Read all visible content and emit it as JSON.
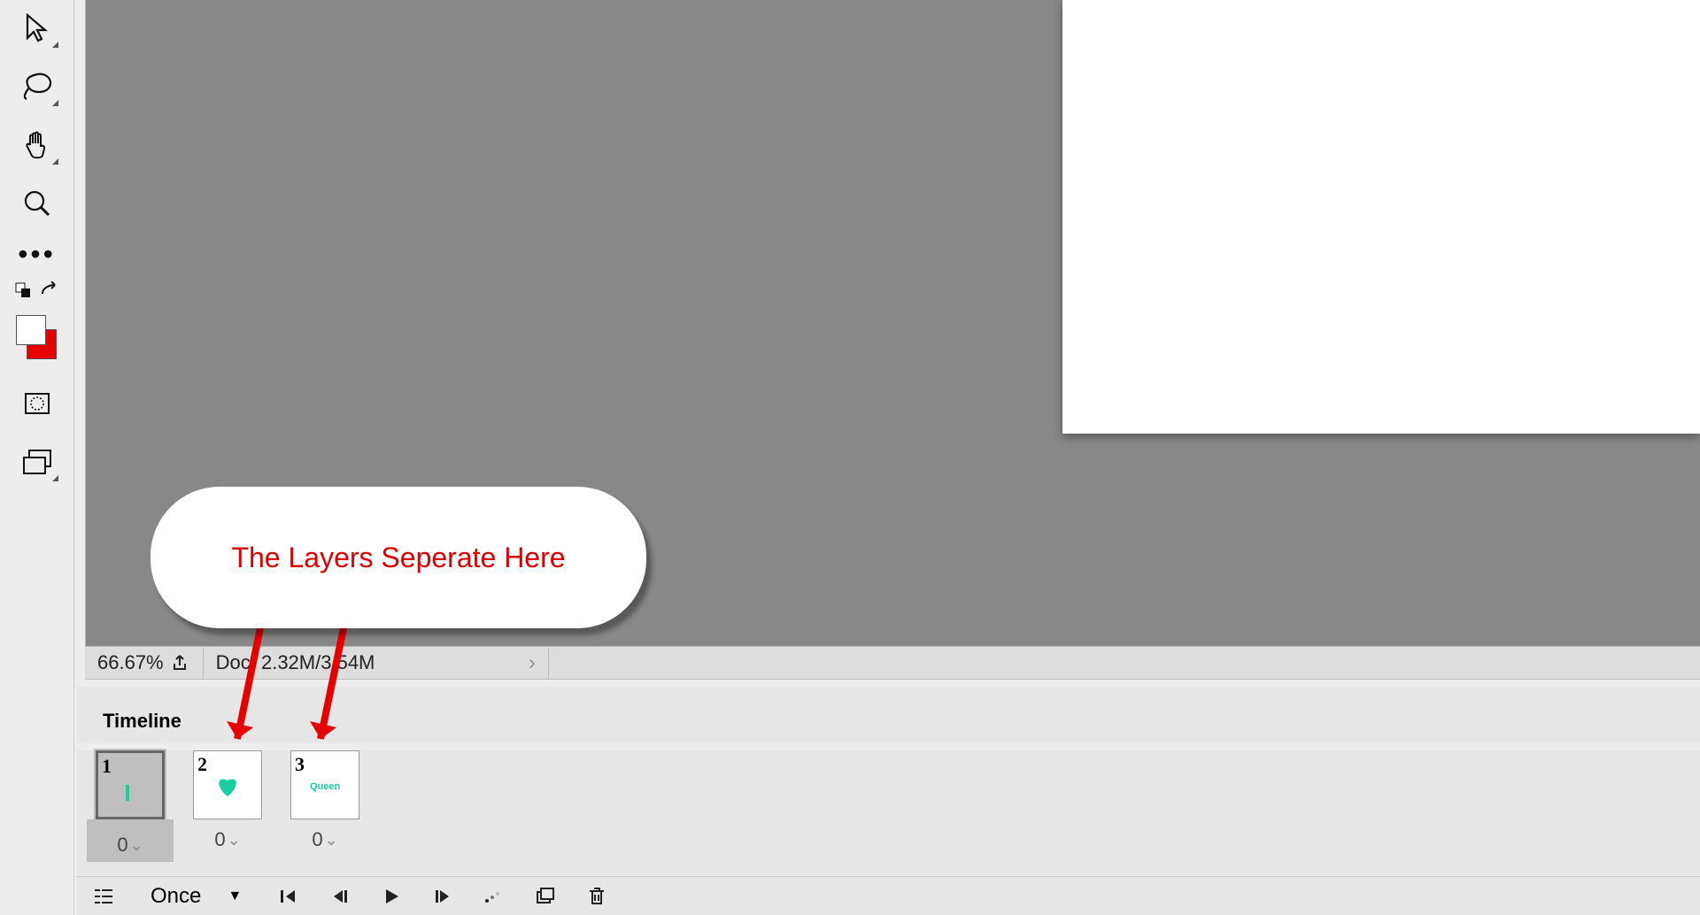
{
  "status": {
    "zoom": "66.67%",
    "doc_info": "Doc: 2.32M/3.54M"
  },
  "timeline": {
    "tab_label": "Timeline",
    "frames": [
      {
        "num": "1",
        "duration": "0",
        "selected": true
      },
      {
        "num": "2",
        "duration": "0",
        "selected": false
      },
      {
        "num": "3",
        "duration": "0",
        "selected": false
      }
    ],
    "loop_mode": "Once"
  },
  "annotation": {
    "text": "The Layers Seperate Here"
  },
  "colors": {
    "foreground": "#ffffff",
    "background": "#e60000"
  }
}
